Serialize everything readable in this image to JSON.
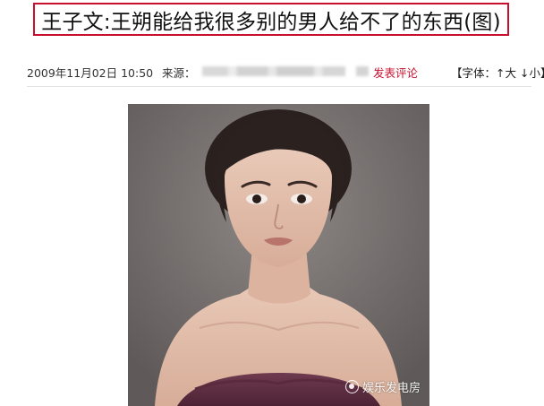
{
  "article": {
    "headline": "王子文:王朔能给我很多别的男人给不了的东西(图)",
    "date": "2009年11月02日 10:50",
    "source_label": "来源：",
    "comment_link": "发表评论",
    "font_size_label": "【字体：",
    "font_up": "↑大",
    "font_down": "↓小】"
  },
  "watermark": {
    "text": "娱乐发电房"
  },
  "colors": {
    "headline_border": "#c8102e",
    "link": "#c8102e"
  }
}
